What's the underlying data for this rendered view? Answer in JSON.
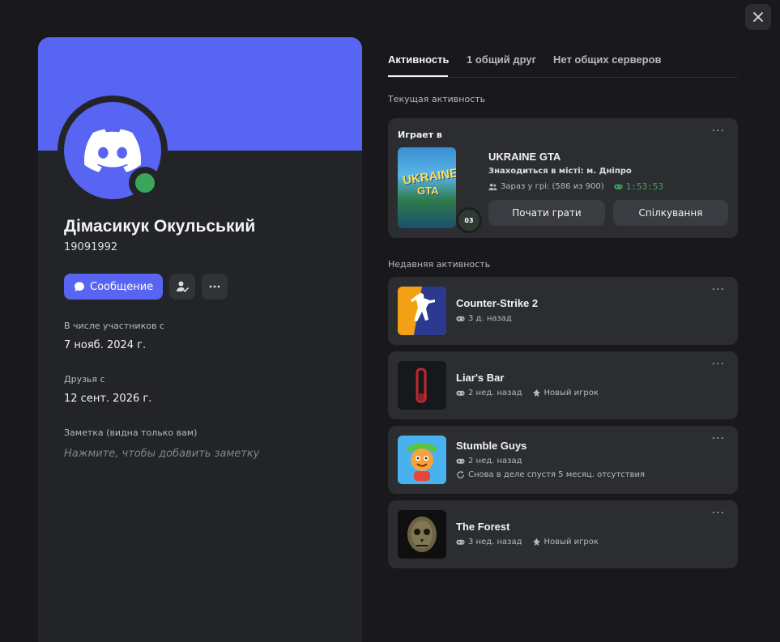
{
  "window": {
    "close_label": "✕"
  },
  "profile": {
    "display_name": "Дімасикук Окульський",
    "username": "19091992",
    "message_button": "Сообщение",
    "member_since_label": "В числе участников с",
    "member_since_value": "7 нояб. 2024 г.",
    "friends_since_label": "Друзья с",
    "friends_since_value": "12 сент. 2026 г.",
    "note_label": "Заметка (видна только вам)",
    "note_placeholder": "Нажмите, чтобы добавить заметку",
    "status": "online",
    "banner_color": "#5865f2"
  },
  "tabs": [
    {
      "label": "Активность",
      "active": true
    },
    {
      "label": "1 общий друг",
      "active": false
    },
    {
      "label": "Нет общих серверов",
      "active": false
    }
  ],
  "current_activity": {
    "section_label": "Текущая активность",
    "playing_label": "Играет в",
    "more": "···",
    "game": "UKRAINE GTA",
    "thumb_text_top": "UKRAINE",
    "thumb_text_bottom": "GTA",
    "badge": "03",
    "details": "Знаходиться в місті: м. Дніпро",
    "party": "Зараз у грі: (586 из 900)",
    "elapsed": "1:53:53",
    "buttons": [
      "Почати грати",
      "Спілкування"
    ]
  },
  "recent_activity": {
    "section_label": "Недавняя активность",
    "items": [
      {
        "title": "Counter-Strike 2",
        "played": "3 д. назад",
        "extra": "",
        "more": "···"
      },
      {
        "title": "Liar's Bar",
        "played": "2 нед. назад",
        "extra": "Новый игрок",
        "more": "···"
      },
      {
        "title": "Stumble Guys",
        "played": "2 нед. назад",
        "extra": "Снова в деле спустя 5 месяц. отсутствия",
        "more": "···"
      },
      {
        "title": "The Forest",
        "played": "3 нед. назад",
        "extra": "Новый игрок",
        "more": "···"
      }
    ]
  },
  "colors": {
    "accent": "#5865f2",
    "online": "#3ba55c",
    "background": "#19191c",
    "card": "#2b2d31"
  }
}
